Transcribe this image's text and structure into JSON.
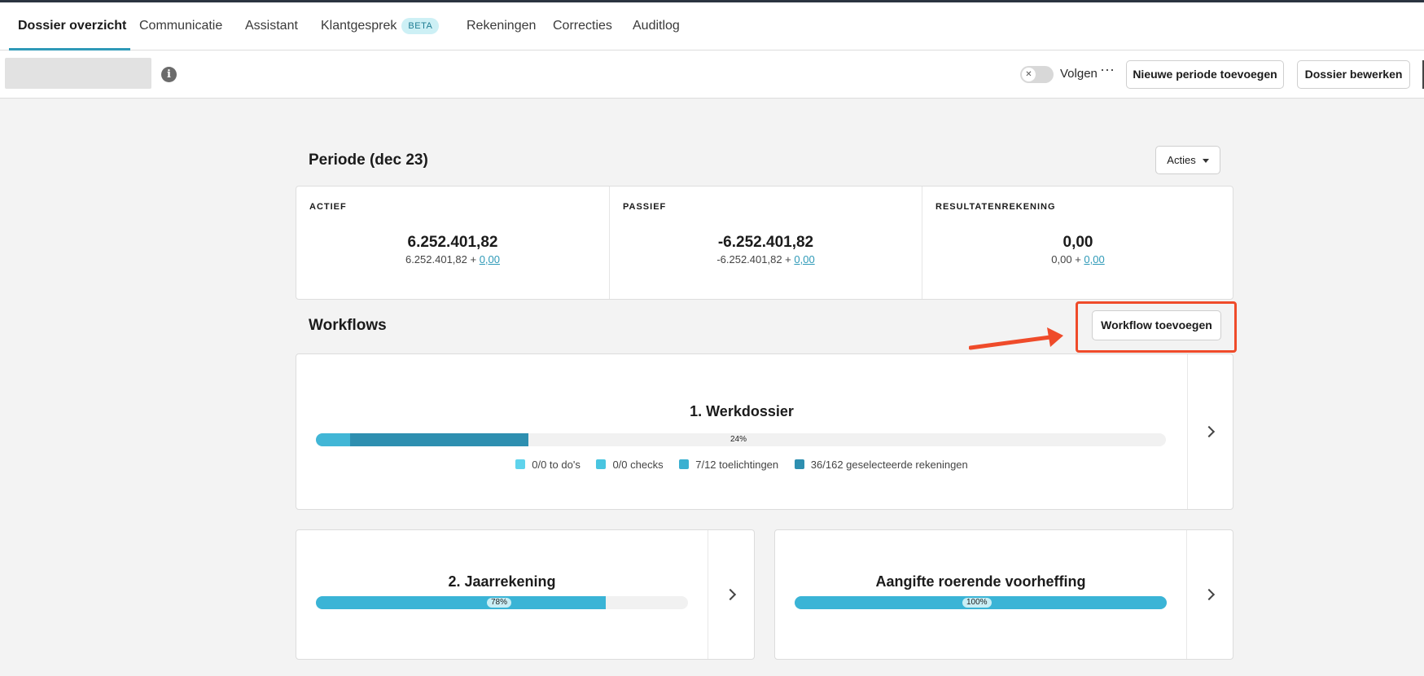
{
  "tabs": [
    {
      "label": "Dossier overzicht",
      "active": true
    },
    {
      "label": "Communicatie"
    },
    {
      "label": "Assistant"
    },
    {
      "label": "Klantgesprek",
      "badge": "BETA"
    },
    {
      "label": "Rekeningen"
    },
    {
      "label": "Correcties"
    },
    {
      "label": "Auditlog"
    }
  ],
  "subheader": {
    "follow_label": "Volgen",
    "more_icon": "more-horizontal-icon",
    "new_period_button": "Nieuwe periode toevoegen",
    "edit_dossier_button": "Dossier bewerken"
  },
  "period": {
    "title": "Periode (dec 23)",
    "actions_button": "Acties"
  },
  "balance": {
    "columns": [
      {
        "label": "ACTIEF",
        "total": "6.252.401,82",
        "base": "6.252.401,82 + ",
        "correction": "0,00"
      },
      {
        "label": "PASSIEF",
        "total": "-6.252.401,82",
        "base": "-6.252.401,82 + ",
        "correction": "0,00"
      },
      {
        "label": "RESULTATENREKENING",
        "total": "0,00",
        "base": "0,00 + ",
        "correction": "0,00"
      }
    ]
  },
  "workflows": {
    "title": "Workflows",
    "add_button": "Workflow toevoegen",
    "items": [
      {
        "name": "1. Werkdossier",
        "progress_label": "24%",
        "segments": [
          {
            "fraction": 0.04,
            "color": "#41b6d6"
          },
          {
            "fraction": 0.21,
            "color": "#2e8fb0"
          }
        ],
        "legend": [
          {
            "label": "0/0 to do's",
            "color": "#5fd3ec"
          },
          {
            "label": "0/0 checks",
            "color": "#49c5e0"
          },
          {
            "label": "7/12 toelichtingen",
            "color": "#3ab0d1"
          },
          {
            "label": "36/162 geselecteerde rekeningen",
            "color": "#2e8fb0"
          }
        ]
      },
      {
        "name": "2. Jaarrekening",
        "progress_label": "78%",
        "progress": 0.78,
        "color": "#3ab4d6"
      },
      {
        "name": "Aangifte roerende voorheffing",
        "progress_label": "100%",
        "progress": 1.0,
        "color": "#3ab4d6"
      }
    ]
  },
  "colors": {
    "accent": "#2f9ab8",
    "annotation": "#ef4b2a"
  }
}
